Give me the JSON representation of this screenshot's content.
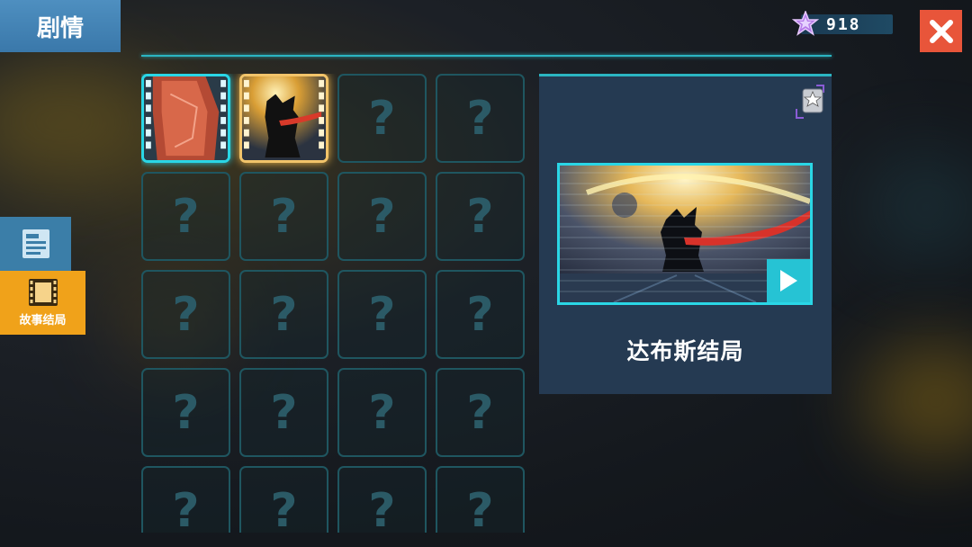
{
  "header": {
    "title": "剧情"
  },
  "currency": {
    "icon": "purple-star-gem-icon",
    "amount": "918"
  },
  "close_button": {
    "icon": "close-icon",
    "color": "#e8553a"
  },
  "side_tabs": [
    {
      "icon": "document-icon",
      "label": ""
    },
    {
      "icon": "film-strip-icon",
      "label": "故事结局"
    }
  ],
  "grid": {
    "columns": 4,
    "rows_visible": 5,
    "locked_symbol": "?",
    "unlocked": [
      "cell-1",
      "cell-2"
    ],
    "selected": "cell-2"
  },
  "detail": {
    "title": "达布斯结局",
    "badge_icon": "star-badge-icon",
    "play_icon": "play-icon"
  },
  "colors": {
    "accent": "#2bb5c2",
    "tab_active": "#f0a21a",
    "title_tab": "#3a78aa",
    "panel": "#253a52"
  }
}
